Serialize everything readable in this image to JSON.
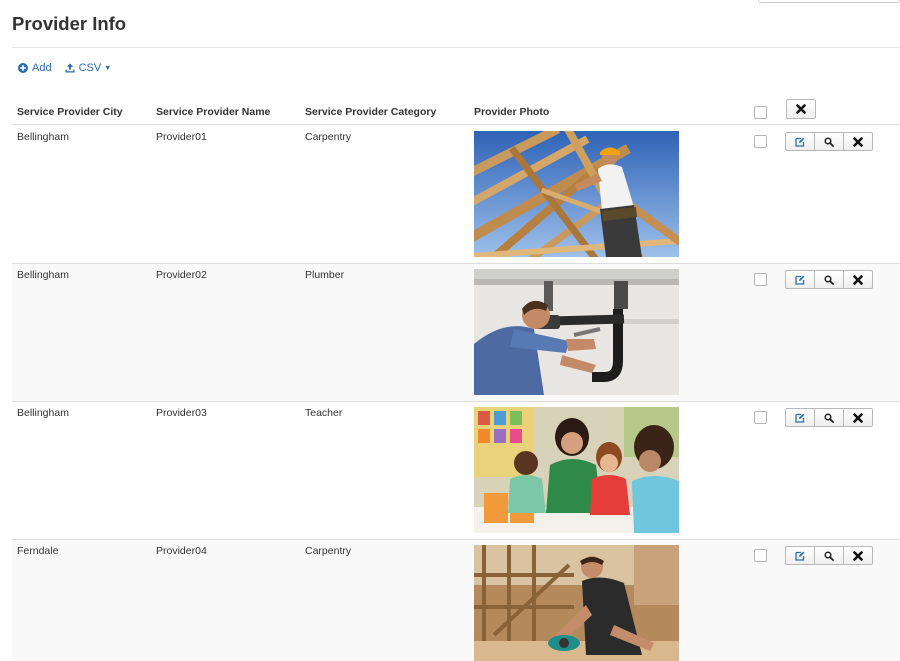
{
  "page": {
    "title": "Provider Info"
  },
  "toolbar": {
    "add_label": "Add",
    "csv_label": "CSV"
  },
  "table": {
    "columns": [
      "Service Provider City",
      "Service Provider Name",
      "Service Provider Category",
      "Provider Photo"
    ],
    "rows": [
      {
        "city": "Bellingham",
        "name": "Provider01",
        "category": "Carpentry",
        "photo": "roof-framing-carpenter"
      },
      {
        "city": "Bellingham",
        "name": "Provider02",
        "category": "Plumber",
        "photo": "plumber-under-sink"
      },
      {
        "city": "Bellingham",
        "name": "Provider03",
        "category": "Teacher",
        "photo": "teacher-with-children"
      },
      {
        "city": "Ferndale",
        "name": "Provider04",
        "category": "Carpentry",
        "photo": "woodworker-with-saw"
      }
    ]
  },
  "icons": {
    "add": "plus-circle-icon",
    "csv": "upload-icon",
    "edit": "edit-icon",
    "view": "search-icon",
    "delete": "close-icon"
  },
  "colors": {
    "link": "#2a6db0",
    "border": "#dddddd",
    "alt_row": "#f9f9f9"
  }
}
